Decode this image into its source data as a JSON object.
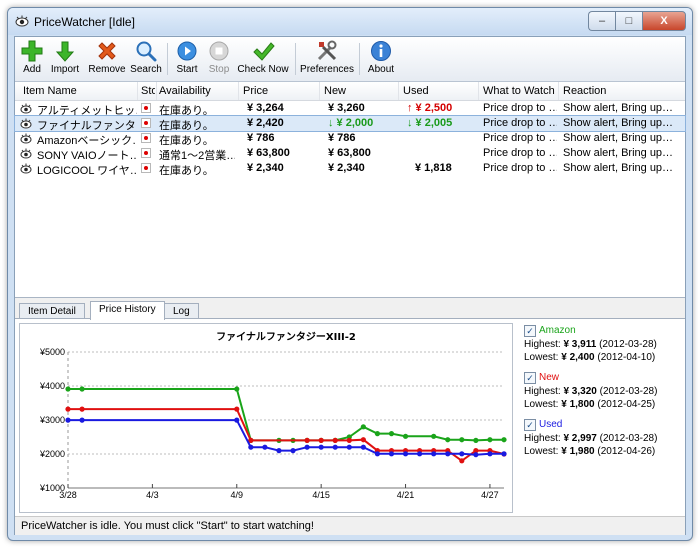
{
  "window": {
    "title": "PriceWatcher [Idle]",
    "minimize_glyph": "–",
    "maximize_glyph": "□",
    "close_glyph": "X"
  },
  "toolbar": {
    "items": [
      {
        "label": "Add",
        "icon": "add-icon"
      },
      {
        "label": "Import",
        "icon": "import-icon"
      },
      {
        "label": "Remove",
        "icon": "remove-icon"
      },
      {
        "label": "Search",
        "icon": "search-icon"
      },
      {
        "label": "Start",
        "icon": "start-icon"
      },
      {
        "label": "Stop",
        "icon": "stop-icon",
        "disabled": true
      },
      {
        "label": "Check Now",
        "icon": "checkmark-icon"
      },
      {
        "label": "Preferences",
        "icon": "tools-icon"
      },
      {
        "label": "About",
        "icon": "info-icon"
      }
    ]
  },
  "list": {
    "columns": [
      "Item Name",
      "Sto",
      "Availability",
      "Price",
      "New",
      "Used",
      "What to Watch",
      "Reaction"
    ],
    "rows": [
      {
        "name": "アルティメットヒッ…",
        "availability": "在庫あり。",
        "price": "¥ 3,264",
        "new": "¥ 3,260",
        "new_arrow": "",
        "used": "↑ ¥ 2,500",
        "used_trend": "up",
        "watch": "Price drop to …",
        "reaction": "Show alert, Bring up…"
      },
      {
        "name": "ファイナルファンタ…",
        "availability": "在庫あり。",
        "price": "¥ 2,420",
        "new": "↓ ¥ 2,000",
        "new_trend": "down",
        "used": "↓ ¥ 2,005",
        "used_trend": "down",
        "watch": "Price drop to …",
        "reaction": "Show alert, Bring up…",
        "selected": true
      },
      {
        "name": "Amazonベーシック…",
        "availability": "在庫あり。",
        "price": "¥ 786",
        "new": "¥ 786",
        "used": "",
        "watch": "Price drop to …",
        "reaction": "Show alert, Bring up…"
      },
      {
        "name": "SONY VAIOノート…",
        "availability": "通常1～2営業…",
        "price": "¥ 63,800",
        "new": "¥ 63,800",
        "used": "",
        "watch": "Price drop to …",
        "reaction": "Show alert, Bring up…"
      },
      {
        "name": "LOGICOOL ワイヤ…",
        "availability": "在庫あり。",
        "price": "¥ 2,340",
        "new": "¥ 2,340",
        "used": "¥ 1,818",
        "watch": "Price drop to …",
        "reaction": "Show alert, Bring up…"
      }
    ]
  },
  "tabs": [
    "Item Detail",
    "Price History",
    "Log"
  ],
  "active_tab": "Price History",
  "legend": [
    {
      "name": "Amazon",
      "color": "#1aa41a",
      "checked": true,
      "highest_label": "Highest:",
      "highest": "¥ 3,911",
      "highest_date": "(2012-03-28)",
      "lowest_label": "Lowest:",
      "lowest": "¥ 2,400",
      "lowest_date": "(2012-04-10)"
    },
    {
      "name": "New",
      "color": "#e01010",
      "checked": true,
      "highest_label": "Highest:",
      "highest": "¥ 3,320",
      "highest_date": "(2012-03-28)",
      "lowest_label": "Lowest:",
      "lowest": "¥ 1,800",
      "lowest_date": "(2012-04-25)"
    },
    {
      "name": "Used",
      "color": "#1a1ae0",
      "checked": true,
      "highest_label": "Highest:",
      "highest": "¥ 2,997",
      "highest_date": "(2012-03-28)",
      "lowest_label": "Lowest:",
      "lowest": "¥ 1,980",
      "lowest_date": "(2012-04-26)"
    }
  ],
  "status": "PriceWatcher is idle. You must click \"Start\" to start watching!",
  "chart_data": {
    "type": "line",
    "title": "ファイナルファンタジーXIII-2",
    "xlabel": "",
    "ylabel": "",
    "ylim": [
      1000,
      5000
    ],
    "yticks": [
      1000,
      2000,
      3000,
      4000,
      5000
    ],
    "ytick_labels": [
      "¥1000",
      "¥2000",
      "¥3000",
      "¥4000",
      "¥5000"
    ],
    "xlim": [
      "2012-03-28",
      "2012-04-28"
    ],
    "xticks": [
      "2012-03-28",
      "2012-04-03",
      "2012-04-09",
      "2012-04-15",
      "2012-04-21",
      "2012-04-27"
    ],
    "xtick_labels": [
      "3/28",
      "4/3",
      "4/9",
      "4/15",
      "4/21",
      "4/27"
    ],
    "grid": "horizontal",
    "series": [
      {
        "name": "Amazon",
        "color": "#1aa41a",
        "points": [
          [
            "2012-03-28",
            3911
          ],
          [
            "2012-03-29",
            3911
          ],
          [
            "2012-04-09",
            3911
          ],
          [
            "2012-04-10",
            2400
          ],
          [
            "2012-04-12",
            2400
          ],
          [
            "2012-04-13",
            2400
          ],
          [
            "2012-04-14",
            2400
          ],
          [
            "2012-04-15",
            2400
          ],
          [
            "2012-04-16",
            2400
          ],
          [
            "2012-04-17",
            2500
          ],
          [
            "2012-04-18",
            2800
          ],
          [
            "2012-04-19",
            2600
          ],
          [
            "2012-04-20",
            2600
          ],
          [
            "2012-04-21",
            2520
          ],
          [
            "2012-04-23",
            2520
          ],
          [
            "2012-04-24",
            2420
          ],
          [
            "2012-04-25",
            2420
          ],
          [
            "2012-04-26",
            2400
          ],
          [
            "2012-04-27",
            2420
          ],
          [
            "2012-04-28",
            2420
          ]
        ]
      },
      {
        "name": "New",
        "color": "#e01010",
        "points": [
          [
            "2012-03-28",
            3320
          ],
          [
            "2012-03-29",
            3320
          ],
          [
            "2012-04-09",
            3320
          ],
          [
            "2012-04-10",
            2400
          ],
          [
            "2012-04-14",
            2400
          ],
          [
            "2012-04-15",
            2400
          ],
          [
            "2012-04-16",
            2400
          ],
          [
            "2012-04-17",
            2400
          ],
          [
            "2012-04-18",
            2420
          ],
          [
            "2012-04-19",
            2100
          ],
          [
            "2012-04-20",
            2100
          ],
          [
            "2012-04-21",
            2100
          ],
          [
            "2012-04-22",
            2100
          ],
          [
            "2012-04-23",
            2100
          ],
          [
            "2012-04-24",
            2100
          ],
          [
            "2012-04-25",
            1800
          ],
          [
            "2012-04-26",
            2100
          ],
          [
            "2012-04-27",
            2100
          ],
          [
            "2012-04-28",
            2000
          ]
        ]
      },
      {
        "name": "Used",
        "color": "#1a1ae0",
        "points": [
          [
            "2012-03-28",
            2997
          ],
          [
            "2012-03-29",
            2997
          ],
          [
            "2012-04-09",
            2997
          ],
          [
            "2012-04-10",
            2200
          ],
          [
            "2012-04-11",
            2200
          ],
          [
            "2012-04-12",
            2100
          ],
          [
            "2012-04-13",
            2100
          ],
          [
            "2012-04-14",
            2200
          ],
          [
            "2012-04-15",
            2200
          ],
          [
            "2012-04-16",
            2200
          ],
          [
            "2012-04-17",
            2200
          ],
          [
            "2012-04-18",
            2200
          ],
          [
            "2012-04-19",
            2005
          ],
          [
            "2012-04-20",
            2005
          ],
          [
            "2012-04-21",
            2005
          ],
          [
            "2012-04-22",
            2005
          ],
          [
            "2012-04-23",
            2005
          ],
          [
            "2012-04-24",
            2005
          ],
          [
            "2012-04-25",
            2005
          ],
          [
            "2012-04-26",
            1980
          ],
          [
            "2012-04-27",
            2005
          ],
          [
            "2012-04-28",
            2005
          ]
        ]
      }
    ]
  }
}
